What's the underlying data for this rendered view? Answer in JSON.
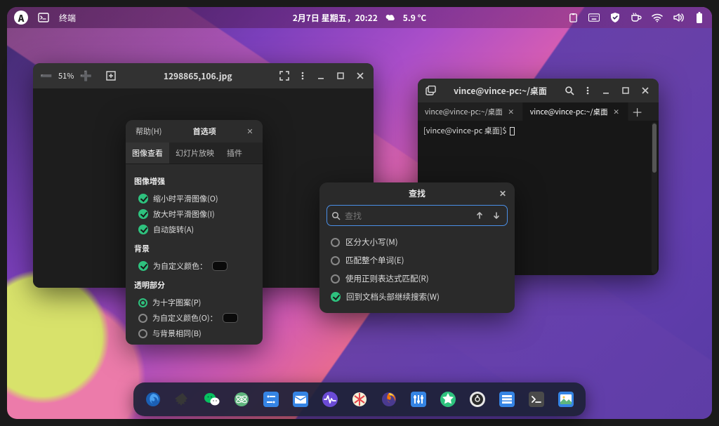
{
  "topbar": {
    "app_label": "终端",
    "datetime": "2月7日 星期五，20:22",
    "weather": "5.9 °C"
  },
  "image_viewer": {
    "zoom": "51%",
    "filename": "1298865,106.jpg"
  },
  "prefs": {
    "help_label": "帮助(H)",
    "title": "首选项",
    "tabs": [
      "图像查看",
      "幻灯片放映",
      "插件"
    ],
    "section_enhance": "图像增强",
    "opt_smooth_out": "缩小时平滑图像(O)",
    "opt_smooth_in": "放大时平滑图像(I)",
    "opt_autorotate": "自动旋转(A)",
    "section_bg": "背景",
    "opt_custom_color_bg": "为自定义颜色：",
    "section_transparent": "透明部分",
    "opt_checker": "为十字图案(P)",
    "opt_custom_color_t": "为自定义颜色(O)：",
    "opt_same_bg": "与背景相同(B)"
  },
  "find": {
    "title": "查找",
    "placeholder": "查找",
    "opt_case": "区分大小写(M)",
    "opt_whole": "匹配整个单词(E)",
    "opt_regex": "使用正则表达式匹配(R)",
    "opt_wrap": "回到文档头部继续搜索(W)"
  },
  "terminal": {
    "title": "vince@vince-pc:~/桌面",
    "tabs": [
      {
        "label": "vince@vince-pc:~/桌面"
      },
      {
        "label": "vince@vince-pc:~/桌面"
      }
    ],
    "prompt": "[vince@vince-pc 桌面]$ "
  },
  "dock": {
    "apps": [
      {
        "name": "firefox-dev",
        "bg": "#0a4fa8"
      },
      {
        "name": "inkscape",
        "bg": "#2a2a2a"
      },
      {
        "name": "wechat",
        "bg": "#07c160"
      },
      {
        "name": "atom",
        "bg": "#5fb57d"
      },
      {
        "name": "settings-panel",
        "bg": "#3584e4"
      },
      {
        "name": "mail",
        "bg": "#3584e4"
      },
      {
        "name": "activity",
        "bg": "#6b4bd6"
      },
      {
        "name": "gravit",
        "bg": "#f5c211"
      },
      {
        "name": "firefox",
        "bg": "#ff7800"
      },
      {
        "name": "tweaks",
        "bg": "#3584e4"
      },
      {
        "name": "spotify",
        "bg": "#2ec27e"
      },
      {
        "name": "obs",
        "bg": "#d9d9d9"
      },
      {
        "name": "files",
        "bg": "#3584e4"
      },
      {
        "name": "terminal",
        "bg": "#4a4a4a"
      },
      {
        "name": "image-viewer",
        "bg": "#3584e4"
      }
    ]
  }
}
